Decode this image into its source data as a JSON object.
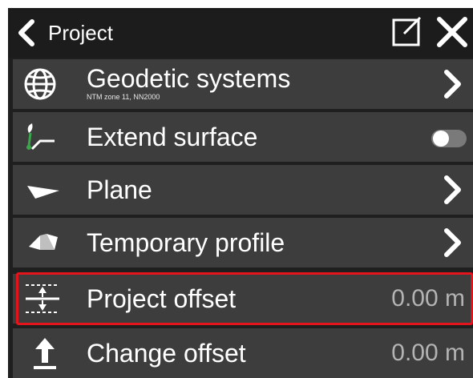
{
  "header": {
    "title": "Project"
  },
  "rows": [
    {
      "label": "Geodetic systems",
      "sublabel": "NTM zone 11, NN2000",
      "control": "chevron",
      "icon": "globe-icon"
    },
    {
      "label": "Extend surface",
      "control": "toggle",
      "toggle_on": false,
      "icon": "extend-surface-icon"
    },
    {
      "label": "Plane",
      "control": "chevron",
      "icon": "plane-icon"
    },
    {
      "label": "Temporary profile",
      "control": "chevron",
      "icon": "temporary-profile-icon"
    },
    {
      "label": "Project offset",
      "value": "0.00 m",
      "control": "value",
      "icon": "project-offset-icon",
      "highlighted": true
    },
    {
      "label": "Change offset",
      "value": "0.00 m",
      "control": "value",
      "icon": "change-offset-icon"
    }
  ],
  "colors": {
    "background": "#1f1f1f",
    "row": "#3d3d3d",
    "highlight": "#e3141b",
    "value_text": "#b3b3b3",
    "icon_accent_green": "#3aa84a"
  }
}
